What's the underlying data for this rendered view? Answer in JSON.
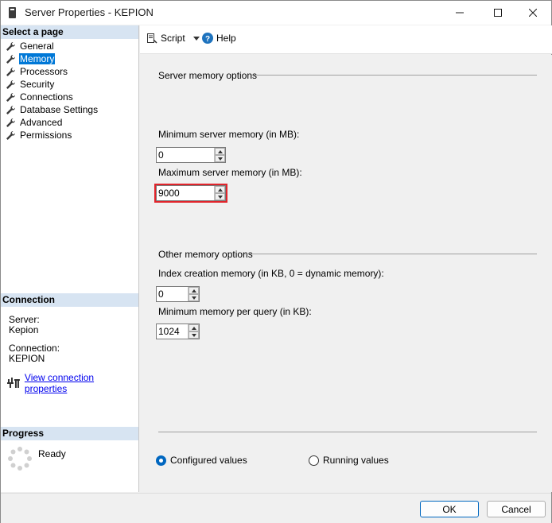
{
  "window": {
    "title": "Server Properties - KEPION"
  },
  "sidebar": {
    "select_page_header": "Select a page",
    "items": [
      {
        "label": "General"
      },
      {
        "label": "Memory",
        "selected": true
      },
      {
        "label": "Processors"
      },
      {
        "label": "Security"
      },
      {
        "label": "Connections"
      },
      {
        "label": "Database Settings"
      },
      {
        "label": "Advanced"
      },
      {
        "label": "Permissions"
      }
    ],
    "connection_header": "Connection",
    "server_label": "Server:",
    "server_value": "Kepion",
    "connection_label": "Connection:",
    "connection_value": "KEPION",
    "view_connection_link": "View connection properties",
    "progress_header": "Progress",
    "progress_status": "Ready"
  },
  "toolbar": {
    "script_label": "Script",
    "help_label": "Help"
  },
  "memory": {
    "server_group_title": "Server memory options",
    "min_label": "Minimum server memory (in MB):",
    "min_value": "0",
    "max_label": "Maximum server memory (in MB):",
    "max_value": "9000",
    "other_group_title": "Other memory options",
    "index_label": "Index creation memory (in KB, 0 = dynamic memory):",
    "index_value": "0",
    "min_query_label": "Minimum memory per query (in KB):",
    "min_query_value": "1024",
    "configured_label": "Configured values",
    "running_label": "Running values",
    "selected_view": "configured"
  },
  "buttons": {
    "ok": "OK",
    "cancel": "Cancel"
  },
  "colors": {
    "selection": "#0078d7",
    "section_header_bg": "#d7e4f2",
    "highlight_border": "#e0242b",
    "link": "#0000ee"
  }
}
